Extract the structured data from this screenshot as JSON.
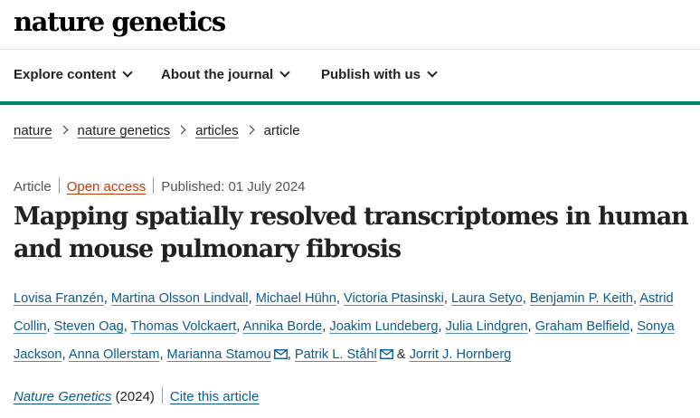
{
  "site": {
    "logo": "nature genetics"
  },
  "nav": {
    "items": [
      {
        "label": "Explore content"
      },
      {
        "label": "About the journal"
      },
      {
        "label": "Publish with us"
      }
    ]
  },
  "breadcrumb": {
    "items": [
      "nature",
      "nature genetics",
      "articles"
    ],
    "current": "article"
  },
  "article": {
    "type": "Article",
    "access": "Open access",
    "published": "Published: 01 July 2024",
    "title": "Mapping spatially resolved transcriptomes in human and mouse pulmonary fibrosis",
    "authors": [
      "Lovisa Franzén",
      "Martina Olsson Lindvall",
      "Michael Hühn",
      "Victoria Ptasinski",
      "Laura Setyo",
      "Benjamin P. Keith",
      "Astrid Collin",
      "Steven Oag",
      "Thomas Volckaert",
      "Annika Borde",
      "Joakim Lundeberg",
      "Julia Lindgren",
      "Graham Belfield",
      "Sonya Jackson",
      "Anna Ollerstam",
      "Marianna Stamou",
      "Patrik L. Ståhl",
      "Jorrit J. Hornberg"
    ],
    "author_separator": ",",
    "last_author_joiner": "&",
    "journal": "Nature Genetics",
    "year": "(2024)",
    "cite_label": "Cite this article"
  },
  "colors": {
    "accent": "#01836a",
    "link": "#0c5b8c",
    "open_access": "#c23c0a"
  },
  "icons": {
    "email": "envelope-icon",
    "chevron": "chevron-down-icon",
    "separator": "chevron-right-icon"
  }
}
